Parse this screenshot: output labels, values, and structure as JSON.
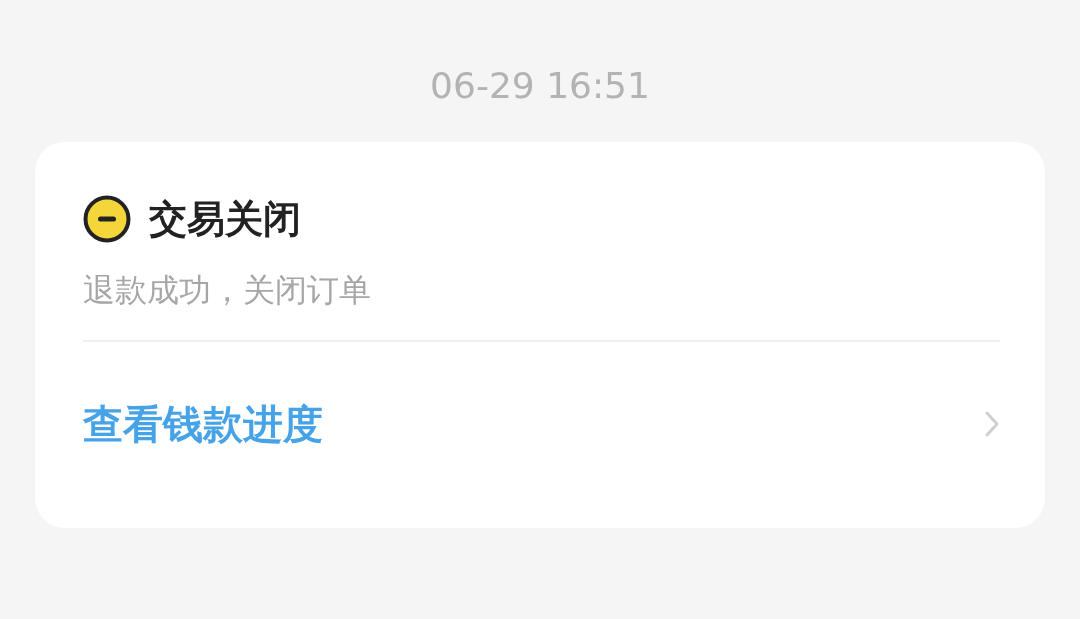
{
  "timestamp": "06-29 16:51",
  "order_status": {
    "title": "交易关闭",
    "description": "退款成功，关闭订单"
  },
  "link": {
    "label": "查看钱款进度"
  }
}
